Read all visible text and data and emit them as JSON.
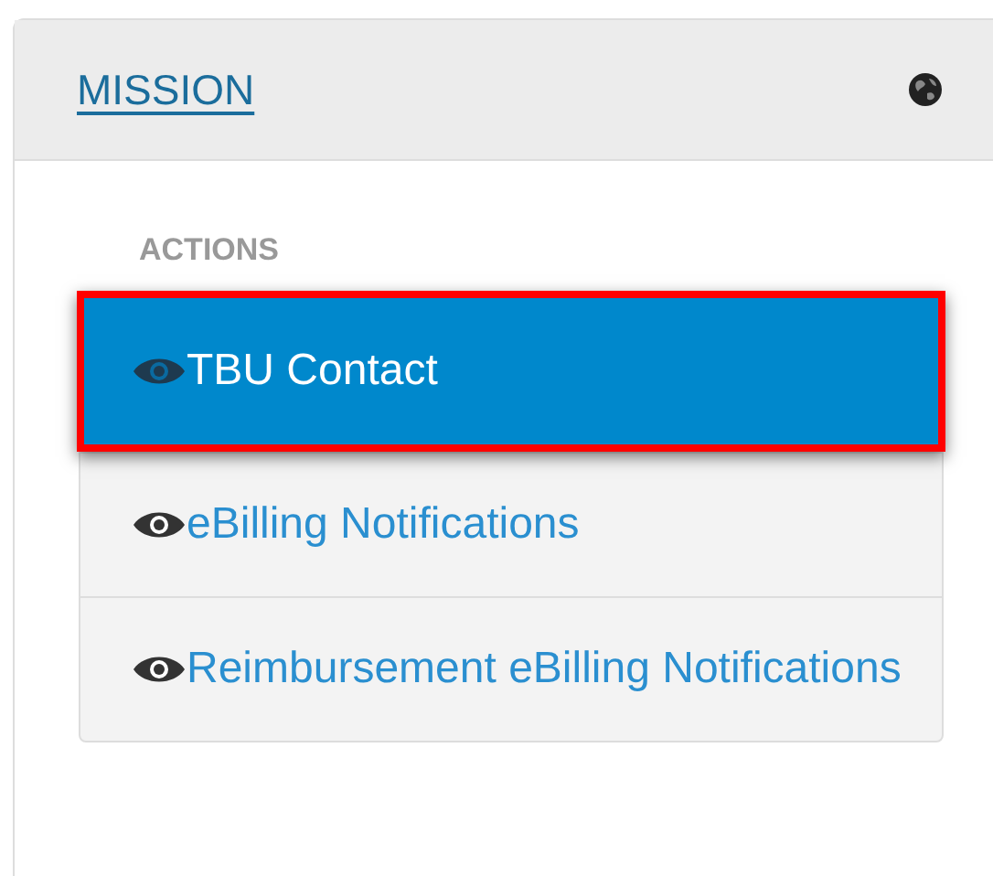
{
  "panel": {
    "title": "MISSION",
    "section_heading": "ACTIONS",
    "actions": [
      {
        "label": "TBU Contact",
        "selected": true
      },
      {
        "label": "eBilling Notifications",
        "selected": false
      },
      {
        "label": "Reimbursement eBilling Notifications",
        "selected": false
      }
    ]
  }
}
